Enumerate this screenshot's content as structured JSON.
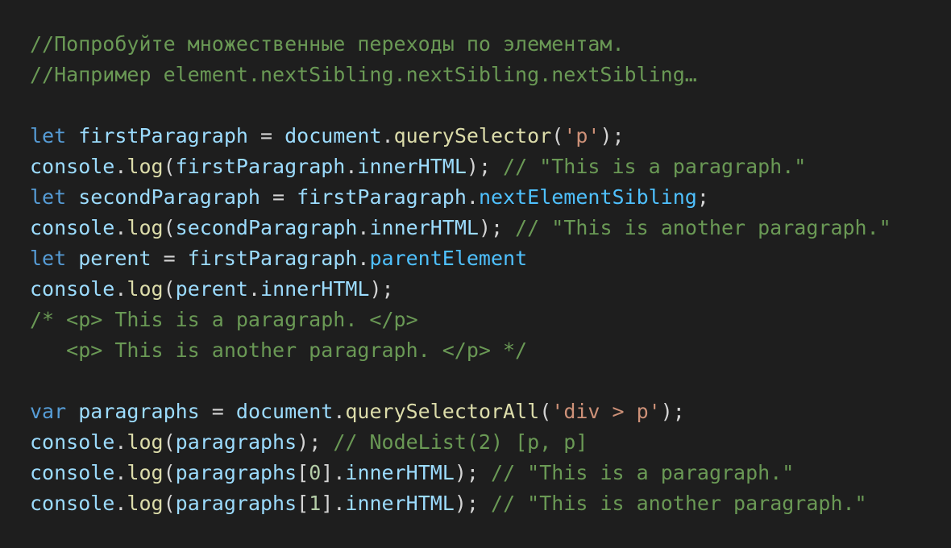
{
  "theme": {
    "background": "#1e1e1e",
    "keyword": "#569cd6",
    "variable": "#9cdcfe",
    "property": "#4fc1ff",
    "function": "#dcdcaa",
    "string": "#ce9178",
    "number": "#b5cea8",
    "comment": "#6a9955",
    "punctuation": "#d4d4d4"
  },
  "code": {
    "lines": [
      [
        {
          "t": "cmt",
          "v": "//Попробуйте множественные переходы по элементам."
        }
      ],
      [
        {
          "t": "cmt",
          "v": "//Например element.nextSibling.nextSibling.nextSibling…"
        }
      ],
      [],
      [
        {
          "t": "kw",
          "v": "let"
        },
        {
          "t": "pun",
          "v": " "
        },
        {
          "t": "var",
          "v": "firstParagraph"
        },
        {
          "t": "pun",
          "v": " = "
        },
        {
          "t": "var",
          "v": "document"
        },
        {
          "t": "pun",
          "v": "."
        },
        {
          "t": "fn",
          "v": "querySelector"
        },
        {
          "t": "pun",
          "v": "("
        },
        {
          "t": "str",
          "v": "'p'"
        },
        {
          "t": "pun",
          "v": ");"
        }
      ],
      [
        {
          "t": "var",
          "v": "console"
        },
        {
          "t": "pun",
          "v": "."
        },
        {
          "t": "fn",
          "v": "log"
        },
        {
          "t": "pun",
          "v": "("
        },
        {
          "t": "var",
          "v": "firstParagraph"
        },
        {
          "t": "pun",
          "v": "."
        },
        {
          "t": "var",
          "v": "innerHTML"
        },
        {
          "t": "pun",
          "v": "); "
        },
        {
          "t": "cmt",
          "v": "// \"This is a paragraph.\""
        }
      ],
      [
        {
          "t": "kw",
          "v": "let"
        },
        {
          "t": "pun",
          "v": " "
        },
        {
          "t": "var",
          "v": "secondParagraph"
        },
        {
          "t": "pun",
          "v": " = "
        },
        {
          "t": "var",
          "v": "firstParagraph"
        },
        {
          "t": "pun",
          "v": "."
        },
        {
          "t": "prop",
          "v": "nextElementSibling"
        },
        {
          "t": "pun",
          "v": ";"
        }
      ],
      [
        {
          "t": "var",
          "v": "console"
        },
        {
          "t": "pun",
          "v": "."
        },
        {
          "t": "fn",
          "v": "log"
        },
        {
          "t": "pun",
          "v": "("
        },
        {
          "t": "var",
          "v": "secondParagraph"
        },
        {
          "t": "pun",
          "v": "."
        },
        {
          "t": "var",
          "v": "innerHTML"
        },
        {
          "t": "pun",
          "v": "); "
        },
        {
          "t": "cmt",
          "v": "// \"This is another paragraph.\""
        }
      ],
      [
        {
          "t": "kw",
          "v": "let"
        },
        {
          "t": "pun",
          "v": " "
        },
        {
          "t": "var",
          "v": "perent"
        },
        {
          "t": "pun",
          "v": " = "
        },
        {
          "t": "var",
          "v": "firstParagraph"
        },
        {
          "t": "pun",
          "v": "."
        },
        {
          "t": "prop",
          "v": "parentElement"
        }
      ],
      [
        {
          "t": "var",
          "v": "console"
        },
        {
          "t": "pun",
          "v": "."
        },
        {
          "t": "fn",
          "v": "log"
        },
        {
          "t": "pun",
          "v": "("
        },
        {
          "t": "var",
          "v": "perent"
        },
        {
          "t": "pun",
          "v": "."
        },
        {
          "t": "var",
          "v": "innerHTML"
        },
        {
          "t": "pun",
          "v": ");"
        }
      ],
      [
        {
          "t": "cmt",
          "v": "/* <p> This is a paragraph. </p>"
        }
      ],
      [
        {
          "t": "cmt",
          "v": "   <p> This is another paragraph. </p> */"
        }
      ],
      [],
      [
        {
          "t": "kw",
          "v": "var"
        },
        {
          "t": "pun",
          "v": " "
        },
        {
          "t": "var",
          "v": "paragraphs"
        },
        {
          "t": "pun",
          "v": " = "
        },
        {
          "t": "var",
          "v": "document"
        },
        {
          "t": "pun",
          "v": "."
        },
        {
          "t": "fn",
          "v": "querySelectorAll"
        },
        {
          "t": "pun",
          "v": "("
        },
        {
          "t": "str",
          "v": "'div > p'"
        },
        {
          "t": "pun",
          "v": ");"
        }
      ],
      [
        {
          "t": "var",
          "v": "console"
        },
        {
          "t": "pun",
          "v": "."
        },
        {
          "t": "fn",
          "v": "log"
        },
        {
          "t": "pun",
          "v": "("
        },
        {
          "t": "var",
          "v": "paragraphs"
        },
        {
          "t": "pun",
          "v": "); "
        },
        {
          "t": "cmt",
          "v": "// NodeList(2) [p, p]"
        }
      ],
      [
        {
          "t": "var",
          "v": "console"
        },
        {
          "t": "pun",
          "v": "."
        },
        {
          "t": "fn",
          "v": "log"
        },
        {
          "t": "pun",
          "v": "("
        },
        {
          "t": "var",
          "v": "paragraphs"
        },
        {
          "t": "pun",
          "v": "["
        },
        {
          "t": "num",
          "v": "0"
        },
        {
          "t": "pun",
          "v": "]."
        },
        {
          "t": "var",
          "v": "innerHTML"
        },
        {
          "t": "pun",
          "v": "); "
        },
        {
          "t": "cmt",
          "v": "// \"This is a paragraph.\""
        }
      ],
      [
        {
          "t": "var",
          "v": "console"
        },
        {
          "t": "pun",
          "v": "."
        },
        {
          "t": "fn",
          "v": "log"
        },
        {
          "t": "pun",
          "v": "("
        },
        {
          "t": "var",
          "v": "paragraphs"
        },
        {
          "t": "pun",
          "v": "["
        },
        {
          "t": "num",
          "v": "1"
        },
        {
          "t": "pun",
          "v": "]."
        },
        {
          "t": "var",
          "v": "innerHTML"
        },
        {
          "t": "pun",
          "v": "); "
        },
        {
          "t": "cmt",
          "v": "// \"This is another paragraph.\""
        }
      ]
    ]
  }
}
